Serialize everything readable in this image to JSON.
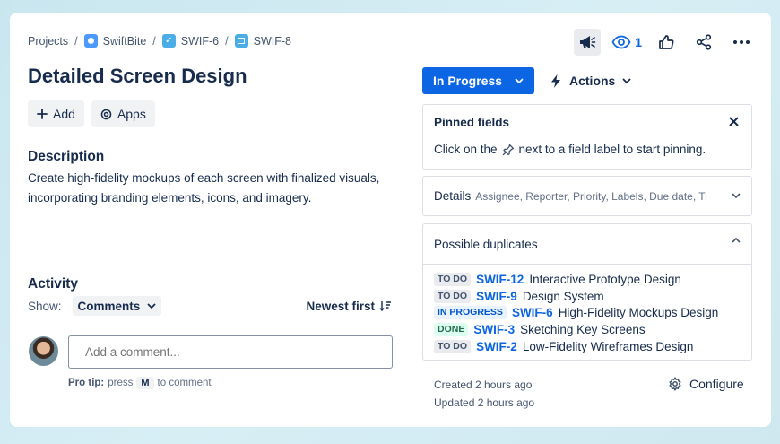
{
  "breadcrumb": {
    "projects": "Projects",
    "project": "SwiftBite",
    "parent": "SWIF-6",
    "current": "SWIF-8",
    "separator": "/"
  },
  "header": {
    "watch_count": "1"
  },
  "issue": {
    "title": "Detailed Screen Design",
    "add_label": "Add",
    "apps_label": "Apps",
    "description_heading": "Description",
    "description": "Create high-fidelity mockups of each screen with finalized visuals, incorporating branding elements, icons, and imagery."
  },
  "activity": {
    "heading": "Activity",
    "show_label": "Show:",
    "filter_value": "Comments",
    "sort_label": "Newest first",
    "comment_placeholder": "Add a comment...",
    "protip_label": "Pro tip:",
    "protip_press": "press",
    "protip_key": "M",
    "protip_suffix": "to comment"
  },
  "status": {
    "label": "In Progress",
    "actions_label": "Actions"
  },
  "pinned": {
    "heading": "Pinned fields",
    "text_before": "Click on the",
    "text_after": "next to a field label to start pinning."
  },
  "details": {
    "heading": "Details",
    "fields": "Assignee, Reporter, Priority, Labels, Due date, Ti..."
  },
  "duplicates": {
    "heading": "Possible duplicates",
    "items": [
      {
        "status": "TO DO",
        "key": "SWIF-12",
        "title": "Interactive Prototype Design"
      },
      {
        "status": "TO DO",
        "key": "SWIF-9",
        "title": "Design System"
      },
      {
        "status": "IN PROGRESS",
        "key": "SWIF-6",
        "title": "High-Fidelity Mockups Design"
      },
      {
        "status": "DONE",
        "key": "SWIF-3",
        "title": "Sketching Key Screens"
      },
      {
        "status": "TO DO",
        "key": "SWIF-2",
        "title": "Low-Fidelity Wireframes Design"
      }
    ]
  },
  "footer": {
    "created": "Created 2 hours ago",
    "updated": "Updated 2 hours ago",
    "configure_label": "Configure"
  },
  "colors": {
    "primary": "#0c66e4",
    "text": "#172b4d",
    "subtle": "#44546f",
    "border": "#dcdfe4"
  },
  "icons": [
    "megaphone-icon",
    "eye-icon",
    "thumbs-up-icon",
    "share-icon",
    "more-icon",
    "plus-icon",
    "apps-icon",
    "chevron-down-icon",
    "lightning-icon",
    "close-icon",
    "pin-icon",
    "chevron-up-icon",
    "sort-icon",
    "gear-icon"
  ]
}
